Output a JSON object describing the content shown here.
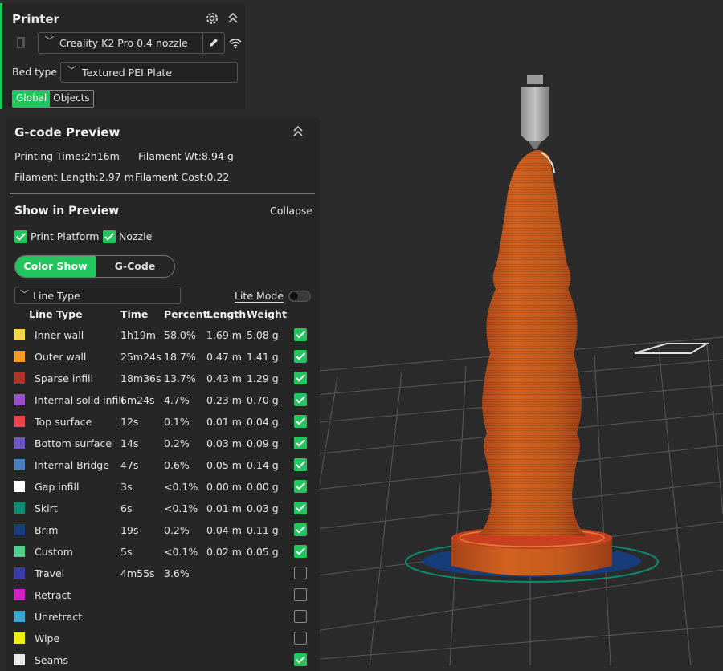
{
  "printer": {
    "title": "Printer",
    "name": "Creality K2 Pro 0.4 nozzle",
    "bed_type_label": "Bed type",
    "bed_type": "Textured PEI Plate",
    "tabs": [
      {
        "label": "Global",
        "active": true
      },
      {
        "label": "Objects",
        "active": false
      }
    ]
  },
  "gcode": {
    "title": "G-code Preview",
    "printing_time": "Printing Time:2h16m",
    "filament_wt": "Filament Wt:8.94 g",
    "filament_length": "Filament Length:2.97 m",
    "filament_cost": "Filament Cost:0.22",
    "show_in_preview": "Show in Preview",
    "collapse": "Collapse",
    "print_platform": "Print Platform",
    "print_platform_checked": true,
    "nozzle": "Nozzle",
    "nozzle_checked": true,
    "modes": [
      {
        "label": "Color Show",
        "active": true
      },
      {
        "label": "G-Code",
        "active": false
      }
    ],
    "view_type": "Line Type",
    "lite_mode": "Lite Mode",
    "lite_mode_on": false,
    "headers": [
      "Line Type",
      "Time",
      "Percent",
      "Length",
      "Weight"
    ],
    "rows": [
      {
        "name": "Inner wall",
        "color": "#f6d74a",
        "time": "1h19m",
        "percent": "58.0%",
        "length": "1.69 m",
        "weight": "5.08 g",
        "checked": true
      },
      {
        "name": "Outer wall",
        "color": "#f39c1f",
        "time": "25m24s",
        "percent": "18.7%",
        "length": "0.47 m",
        "weight": "1.41 g",
        "checked": true
      },
      {
        "name": "Sparse infill",
        "color": "#b3322c",
        "time": "18m36s",
        "percent": "13.7%",
        "length": "0.43 m",
        "weight": "1.29 g",
        "checked": true
      },
      {
        "name": "Internal solid infill",
        "color": "#9c4fc9",
        "time": "6m24s",
        "percent": "4.7%",
        "length": "0.23 m",
        "weight": "0.70 g",
        "checked": true
      },
      {
        "name": "Top surface",
        "color": "#e8454a",
        "time": "12s",
        "percent": "0.1%",
        "length": "0.01 m",
        "weight": "0.04 g",
        "checked": true
      },
      {
        "name": "Bottom surface",
        "color": "#6d55c4",
        "time": "14s",
        "percent": "0.2%",
        "length": "0.03 m",
        "weight": "0.09 g",
        "checked": true
      },
      {
        "name": "Internal Bridge",
        "color": "#4a7fc0",
        "time": "47s",
        "percent": "0.6%",
        "length": "0.05 m",
        "weight": "0.14 g",
        "checked": true
      },
      {
        "name": "Gap infill",
        "color": "#ffffff",
        "time": "3s",
        "percent": "<0.1%",
        "length": "0.00 m",
        "weight": "0.00 g",
        "checked": true
      },
      {
        "name": "Skirt",
        "color": "#0f8a70",
        "time": "6s",
        "percent": "<0.1%",
        "length": "0.01 m",
        "weight": "0.03 g",
        "checked": true
      },
      {
        "name": "Brim",
        "color": "#163d7a",
        "time": "19s",
        "percent": "0.2%",
        "length": "0.04 m",
        "weight": "0.11 g",
        "checked": true
      },
      {
        "name": "Custom",
        "color": "#4fcf8a",
        "time": "5s",
        "percent": "<0.1%",
        "length": "0.02 m",
        "weight": "0.05 g",
        "checked": true
      },
      {
        "name": "Travel",
        "color": "#3a3aa8",
        "time": "4m55s",
        "percent": "3.6%",
        "length": "",
        "weight": "",
        "checked": false
      },
      {
        "name": "Retract",
        "color": "#d21fc2",
        "time": "",
        "percent": "",
        "length": "",
        "weight": "",
        "checked": false
      },
      {
        "name": "Unretract",
        "color": "#3aa6d6",
        "time": "",
        "percent": "",
        "length": "",
        "weight": "",
        "checked": false
      },
      {
        "name": "Wipe",
        "color": "#f2ec10",
        "time": "",
        "percent": "",
        "length": "",
        "weight": "",
        "checked": false
      },
      {
        "name": "Seams",
        "color": "#e8e8e8",
        "time": "",
        "percent": "",
        "length": "",
        "weight": "",
        "checked": true
      }
    ]
  },
  "colors": {
    "accent": "#22c55e",
    "model": "#c9581e",
    "background": "#2b2b2b",
    "panel": "#262626"
  }
}
